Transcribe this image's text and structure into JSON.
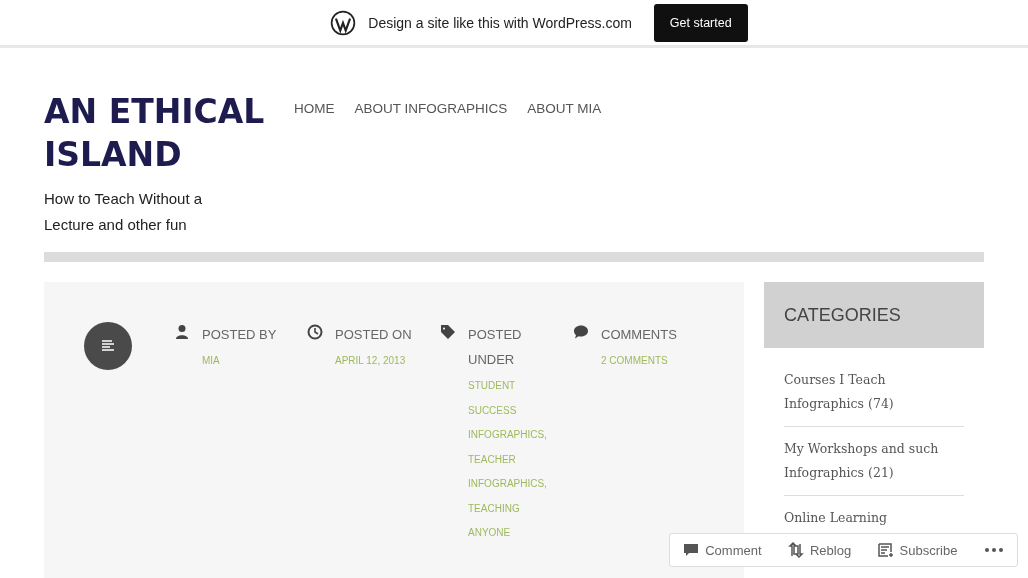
{
  "promo_bar": {
    "text": "Design a site like this with WordPress.com",
    "button": "Get started"
  },
  "site": {
    "title": "AN ETHICAL ISLAND",
    "tagline": "How to Teach Without a Lecture and other fun"
  },
  "nav": [
    "HOME",
    "ABOUT INFOGRAPHICS",
    "ABOUT MIA"
  ],
  "post_meta": [
    {
      "kind": "author",
      "label": "POSTED BY",
      "links": [
        "MIA"
      ]
    },
    {
      "kind": "date",
      "label": "POSTED ON",
      "links": [
        "APRIL 12, 2013"
      ]
    },
    {
      "kind": "tags",
      "label": "POSTED UNDER",
      "links": [
        "STUDENT SUCCESS INFOGRAPHICS,",
        "TEACHER INFOGRAPHICS,",
        "TEACHING ANYONE"
      ]
    },
    {
      "kind": "comments",
      "label": "COMMENTS",
      "links": [
        "2 COMMENTS"
      ]
    }
  ],
  "sidebar": {
    "heading": "CATEGORIES",
    "items": [
      {
        "name": "Courses I Teach Infographics",
        "count": "(74)"
      },
      {
        "name": "My Workshops and such Infographics",
        "count": "(21)"
      },
      {
        "name": "Online Learning"
      }
    ]
  },
  "action_bar": [
    {
      "kind": "comment",
      "label": "Comment"
    },
    {
      "kind": "reblog",
      "label": "Reblog"
    },
    {
      "kind": "subscribe",
      "label": "Subscribe"
    },
    {
      "kind": "more"
    }
  ]
}
